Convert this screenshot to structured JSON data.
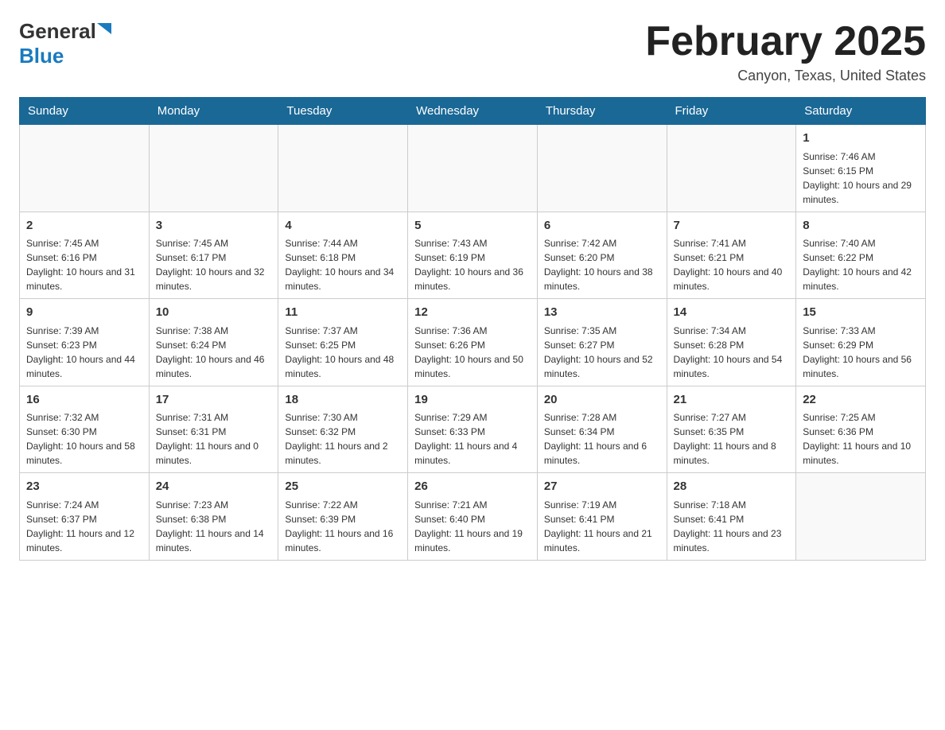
{
  "header": {
    "logo_general": "General",
    "logo_blue": "Blue",
    "month_title": "February 2025",
    "location": "Canyon, Texas, United States"
  },
  "days_of_week": [
    "Sunday",
    "Monday",
    "Tuesday",
    "Wednesday",
    "Thursday",
    "Friday",
    "Saturday"
  ],
  "weeks": [
    [
      {
        "day": "",
        "info": ""
      },
      {
        "day": "",
        "info": ""
      },
      {
        "day": "",
        "info": ""
      },
      {
        "day": "",
        "info": ""
      },
      {
        "day": "",
        "info": ""
      },
      {
        "day": "",
        "info": ""
      },
      {
        "day": "1",
        "info": "Sunrise: 7:46 AM\nSunset: 6:15 PM\nDaylight: 10 hours and 29 minutes."
      }
    ],
    [
      {
        "day": "2",
        "info": "Sunrise: 7:45 AM\nSunset: 6:16 PM\nDaylight: 10 hours and 31 minutes."
      },
      {
        "day": "3",
        "info": "Sunrise: 7:45 AM\nSunset: 6:17 PM\nDaylight: 10 hours and 32 minutes."
      },
      {
        "day": "4",
        "info": "Sunrise: 7:44 AM\nSunset: 6:18 PM\nDaylight: 10 hours and 34 minutes."
      },
      {
        "day": "5",
        "info": "Sunrise: 7:43 AM\nSunset: 6:19 PM\nDaylight: 10 hours and 36 minutes."
      },
      {
        "day": "6",
        "info": "Sunrise: 7:42 AM\nSunset: 6:20 PM\nDaylight: 10 hours and 38 minutes."
      },
      {
        "day": "7",
        "info": "Sunrise: 7:41 AM\nSunset: 6:21 PM\nDaylight: 10 hours and 40 minutes."
      },
      {
        "day": "8",
        "info": "Sunrise: 7:40 AM\nSunset: 6:22 PM\nDaylight: 10 hours and 42 minutes."
      }
    ],
    [
      {
        "day": "9",
        "info": "Sunrise: 7:39 AM\nSunset: 6:23 PM\nDaylight: 10 hours and 44 minutes."
      },
      {
        "day": "10",
        "info": "Sunrise: 7:38 AM\nSunset: 6:24 PM\nDaylight: 10 hours and 46 minutes."
      },
      {
        "day": "11",
        "info": "Sunrise: 7:37 AM\nSunset: 6:25 PM\nDaylight: 10 hours and 48 minutes."
      },
      {
        "day": "12",
        "info": "Sunrise: 7:36 AM\nSunset: 6:26 PM\nDaylight: 10 hours and 50 minutes."
      },
      {
        "day": "13",
        "info": "Sunrise: 7:35 AM\nSunset: 6:27 PM\nDaylight: 10 hours and 52 minutes."
      },
      {
        "day": "14",
        "info": "Sunrise: 7:34 AM\nSunset: 6:28 PM\nDaylight: 10 hours and 54 minutes."
      },
      {
        "day": "15",
        "info": "Sunrise: 7:33 AM\nSunset: 6:29 PM\nDaylight: 10 hours and 56 minutes."
      }
    ],
    [
      {
        "day": "16",
        "info": "Sunrise: 7:32 AM\nSunset: 6:30 PM\nDaylight: 10 hours and 58 minutes."
      },
      {
        "day": "17",
        "info": "Sunrise: 7:31 AM\nSunset: 6:31 PM\nDaylight: 11 hours and 0 minutes."
      },
      {
        "day": "18",
        "info": "Sunrise: 7:30 AM\nSunset: 6:32 PM\nDaylight: 11 hours and 2 minutes."
      },
      {
        "day": "19",
        "info": "Sunrise: 7:29 AM\nSunset: 6:33 PM\nDaylight: 11 hours and 4 minutes."
      },
      {
        "day": "20",
        "info": "Sunrise: 7:28 AM\nSunset: 6:34 PM\nDaylight: 11 hours and 6 minutes."
      },
      {
        "day": "21",
        "info": "Sunrise: 7:27 AM\nSunset: 6:35 PM\nDaylight: 11 hours and 8 minutes."
      },
      {
        "day": "22",
        "info": "Sunrise: 7:25 AM\nSunset: 6:36 PM\nDaylight: 11 hours and 10 minutes."
      }
    ],
    [
      {
        "day": "23",
        "info": "Sunrise: 7:24 AM\nSunset: 6:37 PM\nDaylight: 11 hours and 12 minutes."
      },
      {
        "day": "24",
        "info": "Sunrise: 7:23 AM\nSunset: 6:38 PM\nDaylight: 11 hours and 14 minutes."
      },
      {
        "day": "25",
        "info": "Sunrise: 7:22 AM\nSunset: 6:39 PM\nDaylight: 11 hours and 16 minutes."
      },
      {
        "day": "26",
        "info": "Sunrise: 7:21 AM\nSunset: 6:40 PM\nDaylight: 11 hours and 19 minutes."
      },
      {
        "day": "27",
        "info": "Sunrise: 7:19 AM\nSunset: 6:41 PM\nDaylight: 11 hours and 21 minutes."
      },
      {
        "day": "28",
        "info": "Sunrise: 7:18 AM\nSunset: 6:41 PM\nDaylight: 11 hours and 23 minutes."
      },
      {
        "day": "",
        "info": ""
      }
    ]
  ]
}
